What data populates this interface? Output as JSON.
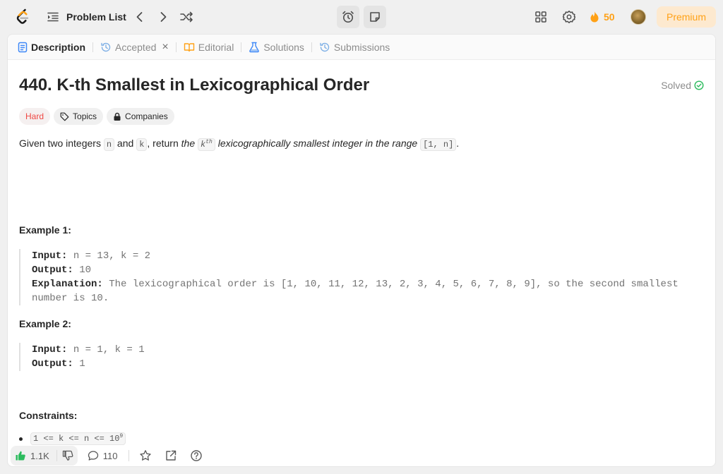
{
  "header": {
    "problem_list_label": "Problem List",
    "streak_count": "50",
    "premium_label": "Premium"
  },
  "tabs": [
    {
      "label": "Description"
    },
    {
      "label": "Accepted"
    },
    {
      "label": "Editorial"
    },
    {
      "label": "Solutions"
    },
    {
      "label": "Submissions"
    }
  ],
  "problem": {
    "title": "440. K-th Smallest in Lexicographical Order",
    "status": "Solved",
    "difficulty": "Hard",
    "tag_topics": "Topics",
    "tag_companies": "Companies",
    "desc": {
      "p1": "Given two integers ",
      "n": "n",
      "p2": " and ",
      "k": "k",
      "p3": ", return ",
      "em1": "the ",
      "kth_k": "k",
      "kth_sup": "th",
      "em2": " lexicographically smallest integer in the range ",
      "range": "[1, n]",
      "p4": "."
    },
    "examples": [
      {
        "heading": "Example 1:",
        "input_label": "Input:",
        "input": " n = 13, k = 2",
        "output_label": "Output:",
        "output": " 10",
        "explanation_label": "Explanation:",
        "explanation_l1": " The lexicographical order is [1, 10, 11, 12, 13, 2, 3, 4, 5, 6, 7, 8, 9], so the second smallest",
        "explanation_l2": "number is 10."
      },
      {
        "heading": "Example 2:",
        "input_label": "Input:",
        "input": " n = 1, k = 1",
        "output_label": "Output:",
        "output": " 1"
      }
    ],
    "constraints_heading": "Constraints:",
    "constraint_text": "1 <= k <= n <= 10",
    "constraint_sup": "9"
  },
  "footer": {
    "likes": "1.1K",
    "comments": "110"
  },
  "colors": {
    "accent": "#ffa116",
    "hard": "#ef4743",
    "solved_check": "#2cbb5d",
    "like_green": "#2cbb5d"
  }
}
